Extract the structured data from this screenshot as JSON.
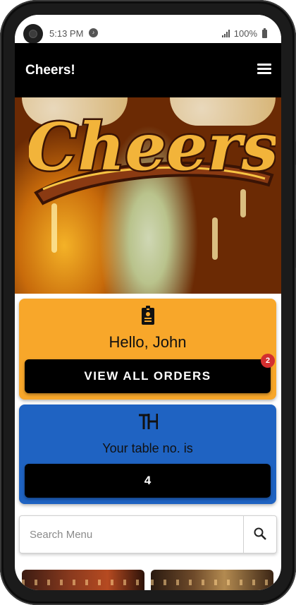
{
  "status_bar": {
    "time": "5:13 PM",
    "battery": "100%",
    "icons": [
      "spotify-icon",
      "signal-icon",
      "battery-icon"
    ]
  },
  "app_bar": {
    "title": "Cheers!",
    "menu_icon": "hamburger-menu-icon"
  },
  "hero": {
    "logo_text": "Cheers"
  },
  "user_card": {
    "icon": "id-badge-icon",
    "greeting": "Hello, John",
    "button_label": "VIEW ALL ORDERS",
    "badge_count": "2",
    "color": "#f8a72a"
  },
  "table_card": {
    "icon": "table-icon",
    "label": "Your table no. is",
    "table_number": "4",
    "color": "#1f63c2"
  },
  "search": {
    "placeholder": "Search Menu",
    "value": "",
    "button_icon": "search-icon"
  }
}
